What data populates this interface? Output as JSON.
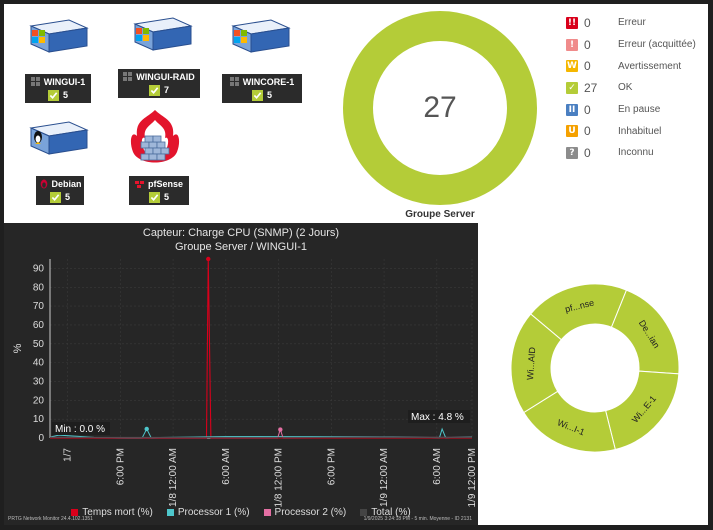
{
  "devices": [
    {
      "name": "WINGUI-1",
      "count": "5",
      "type": "windows"
    },
    {
      "name": "WINGUI-RAID",
      "count": "7",
      "type": "windows"
    },
    {
      "name": "WINCORE-1",
      "count": "5",
      "type": "windows"
    },
    {
      "name": "Debian",
      "count": "5",
      "type": "linux"
    },
    {
      "name": "pfSense",
      "count": "5",
      "type": "firewall"
    }
  ],
  "status": [
    {
      "icon": "error-icon",
      "symbol": "!!",
      "color": "#d9001b",
      "count": "0",
      "label": "Erreur"
    },
    {
      "icon": "error-ack-icon",
      "symbol": "!",
      "color": "#f08b8b",
      "count": "0",
      "label": "Erreur (acquittée)"
    },
    {
      "icon": "warning-icon",
      "symbol": "W",
      "color": "#f5b700",
      "count": "0",
      "label": "Avertissement"
    },
    {
      "icon": "ok-icon",
      "symbol": "✓",
      "color": "#b4cc38",
      "count": "27",
      "label": "OK"
    },
    {
      "icon": "paused-icon",
      "symbol": "II",
      "color": "#4a7fc1",
      "count": "0",
      "label": "En pause"
    },
    {
      "icon": "unusual-icon",
      "symbol": "U",
      "color": "#f5a100",
      "count": "0",
      "label": "Inhabituel"
    },
    {
      "icon": "unknown-icon",
      "symbol": "?",
      "color": "#8c8c8c",
      "count": "0",
      "label": "Inconnu"
    }
  ],
  "group": {
    "total": "27",
    "caption": "Groupe Server",
    "color": "#b4cc38"
  },
  "chart": {
    "title_line1": "Capteur: Charge CPU (SNMP) (2 Jours)",
    "title_line2": "Groupe Server / WINGUI-1",
    "min_label": "Min : 0.0 %",
    "max_label": "Max : 4.8 %",
    "footer_left": "PRTG Network Monitor 24.4.102.1351",
    "footer_right": "1/9/2025 3:24:18 PM - 5 min. Moyenne - ID 2131"
  },
  "chart_data": {
    "type": "line",
    "ylabel": "%",
    "ylim": [
      0,
      95
    ],
    "yticks": [
      0,
      10,
      20,
      30,
      40,
      50,
      60,
      70,
      80,
      90
    ],
    "xlim": [
      0,
      48
    ],
    "xticks": [
      {
        "t": 2,
        "label": "1/7"
      },
      {
        "t": 8,
        "label": "6:00 PM"
      },
      {
        "t": 14,
        "label": "1/8 12:00 AM"
      },
      {
        "t": 20,
        "label": "6:00 AM"
      },
      {
        "t": 26,
        "label": "1/8 12:00 PM"
      },
      {
        "t": 32,
        "label": "6:00 PM"
      },
      {
        "t": 38,
        "label": "1/9 12:00 AM"
      },
      {
        "t": 44,
        "label": "6:00 AM"
      },
      {
        "t": 48,
        "label": "1/9 12:00 PM"
      }
    ],
    "series": [
      {
        "name": "Temps mort (%)",
        "color": "#d9001b",
        "x": [
          0,
          17.8,
          18.0,
          18.3,
          48
        ],
        "y": [
          0,
          0,
          95,
          0,
          0
        ]
      },
      {
        "name": "Processor 1 (%)",
        "color": "#4ec7cc",
        "x": [
          0,
          1,
          5,
          10.5,
          11,
          11.5,
          20,
          30,
          39,
          44.3,
          44.6,
          45,
          48
        ],
        "y": [
          0.5,
          1.5,
          0.3,
          0.2,
          4.8,
          0.2,
          0.8,
          0.7,
          0.5,
          0.2,
          4.8,
          0.2,
          0.5
        ]
      },
      {
        "name": "Processor 2 (%)",
        "color": "#e36fa3",
        "x": [
          0,
          8,
          25.9,
          26.2,
          26.5,
          34,
          48
        ],
        "y": [
          0.3,
          0.2,
          0.2,
          4.5,
          0.2,
          0.3,
          0.3
        ]
      },
      {
        "name": "Total (%)",
        "color": "#444444",
        "x": [
          0,
          48
        ],
        "y": [
          0.3,
          0.3
        ]
      }
    ]
  },
  "sunburst": {
    "color": "#b4cc38",
    "segments": [
      "pf...nse",
      "De...ian",
      "Wi...E-1",
      "Wi...I-1",
      "Wi...AID"
    ]
  }
}
